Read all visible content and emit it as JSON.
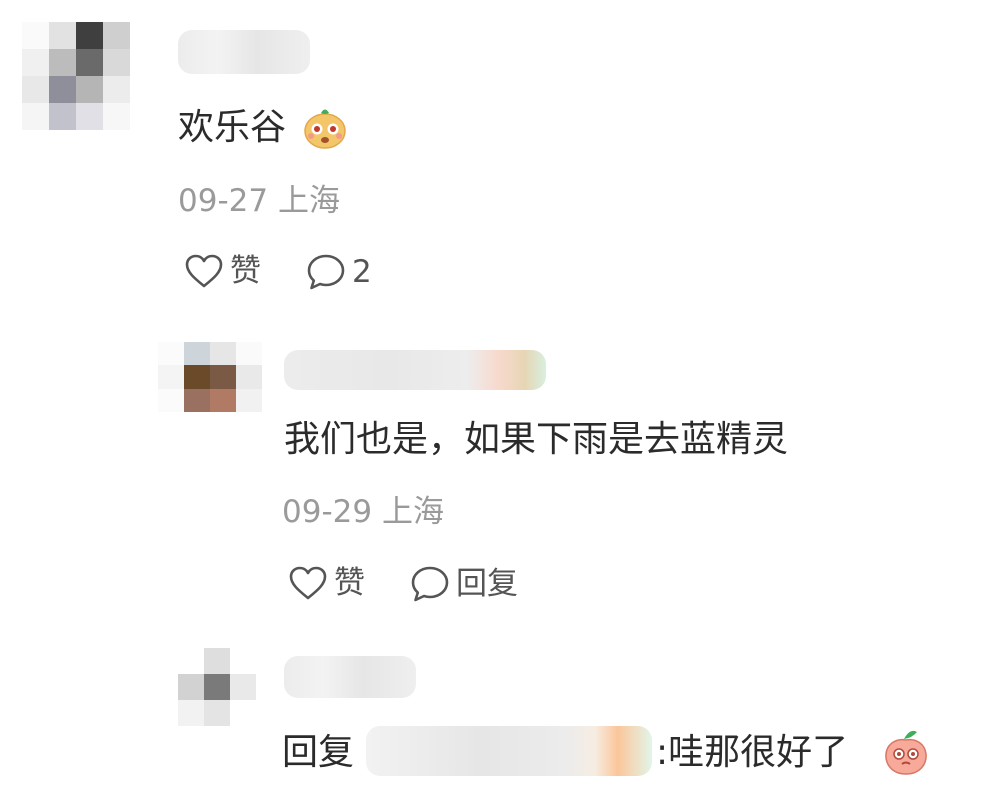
{
  "comments": [
    {
      "text": "欢乐谷",
      "date": "09-27",
      "location": "上海",
      "like_label": "赞",
      "reply_count": "2",
      "emoji": "face-emoji"
    }
  ],
  "replies": [
    {
      "text": "我们也是，如果下雨是去蓝精灵",
      "date": "09-29",
      "location": "上海",
      "like_label": "赞",
      "reply_label": "回复"
    },
    {
      "prefix": "回复",
      "separator": ":",
      "text": "哇那很好了",
      "emoji": "peach-emoji"
    }
  ],
  "icons": {
    "like": "heart-outline-icon",
    "comment": "speech-bubble-icon"
  },
  "colors": {
    "text": "#2b2b2b",
    "meta": "#9a9a9a",
    "action": "#555555"
  }
}
